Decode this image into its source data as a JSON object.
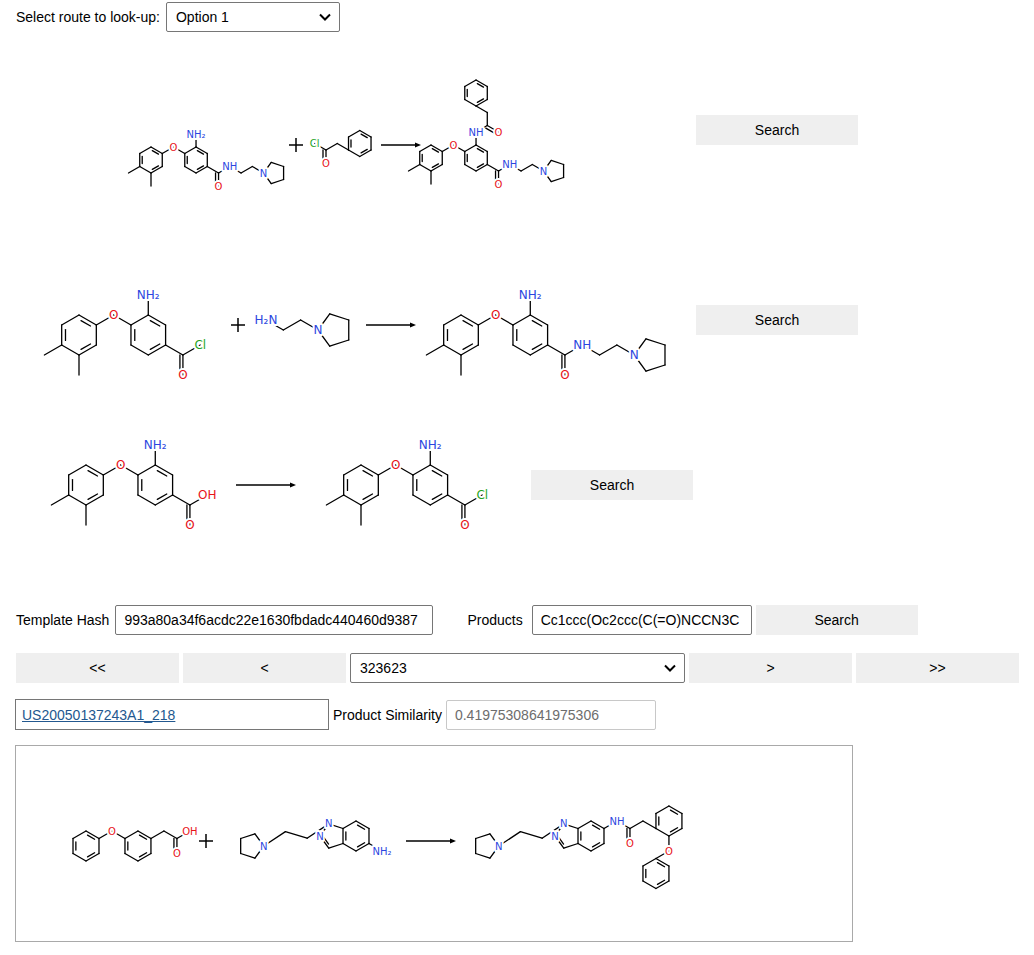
{
  "route_select": {
    "label": "Select route to look-up:",
    "value": "Option 1"
  },
  "route_steps": [
    {
      "reactants": [
        {
          "labels": [
            "O",
            "NH₂",
            "O",
            "NH",
            "N"
          ]
        },
        {
          "labels": [
            "O",
            "Cl"
          ]
        }
      ],
      "product": {
        "labels": [
          "O",
          "NH",
          "O",
          "O",
          "NH",
          "N"
        ]
      },
      "button": "Search"
    },
    {
      "reactants": [
        {
          "labels": [
            "O",
            "NH₂",
            "O",
            "Cl"
          ]
        },
        {
          "labels": [
            "H₂N",
            "N"
          ]
        }
      ],
      "product": {
        "labels": [
          "O",
          "NH₂",
          "O",
          "NH",
          "N"
        ]
      },
      "button": "Search"
    },
    {
      "reactants": [
        {
          "labels": [
            "O",
            "NH₂",
            "O",
            "OH"
          ]
        }
      ],
      "product": {
        "labels": [
          "O",
          "NH₂",
          "O",
          "Cl"
        ]
      },
      "button": "Search"
    }
  ],
  "template_hash": {
    "label": "Template Hash",
    "value": "993a80a34f6acdc22e1630fbdadc440460d9387"
  },
  "products": {
    "label": "Products",
    "value": "Cc1ccc(Oc2ccc(C(=O)NCCN3C"
  },
  "products_search": "Search",
  "navigation": {
    "first": "<<",
    "previous": "<",
    "record": "323623",
    "next": ">",
    "last": ">>"
  },
  "record": {
    "link": "US20050137243A1_218",
    "similarity_label": "Product Similarity",
    "similarity_value": "0.41975308641975306"
  },
  "record_reaction": {
    "reactants": [
      {
        "labels": [
          "O",
          "O",
          "OH"
        ]
      },
      {
        "labels": [
          "N",
          "N",
          "N",
          "NH₂"
        ]
      }
    ],
    "product": {
      "labels": [
        "N",
        "N",
        "N",
        "NH",
        "O",
        "O"
      ]
    }
  }
}
